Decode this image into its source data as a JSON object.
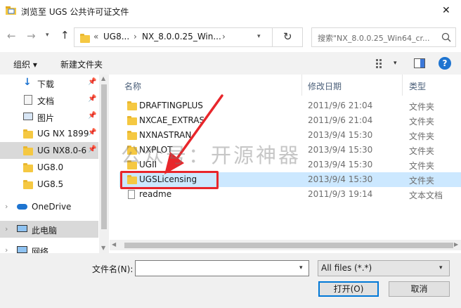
{
  "window": {
    "title": "浏览至 UGS 公共许可证文件",
    "close_glyph": "✕"
  },
  "address": {
    "chevron": "«",
    "crumbs": [
      "UG8...",
      "NX_8.0.0.25_Win..."
    ],
    "separator": "›",
    "search_placeholder": "搜索\"NX_8.0.0.25_Win64_cr..."
  },
  "toolbar": {
    "organize": "组织 ▾",
    "new_folder": "新建文件夹",
    "help": "?"
  },
  "sidebar": {
    "items": [
      {
        "label": "下载",
        "icon": "download-icon",
        "pinned": true
      },
      {
        "label": "文档",
        "icon": "document-icon",
        "pinned": true
      },
      {
        "label": "图片",
        "icon": "picture-icon",
        "pinned": true
      },
      {
        "label": "UG NX 1899",
        "icon": "folder-icon",
        "pinned": true
      },
      {
        "label": "UG NX8.0-6",
        "icon": "folder-icon",
        "pinned": true,
        "selected": true
      },
      {
        "label": "UG8.0",
        "icon": "folder-icon"
      },
      {
        "label": "UG8.5",
        "icon": "folder-icon"
      },
      {
        "label": "OneDrive",
        "icon": "cloud-icon"
      },
      {
        "label": "此电脑",
        "icon": "computer-icon",
        "highlighted": true
      },
      {
        "label": "网络",
        "icon": "network-icon"
      }
    ]
  },
  "columns": {
    "name": "名称",
    "date": "修改日期",
    "type": "类型"
  },
  "files": [
    {
      "name": "DRAFTINGPLUS",
      "date": "2011/9/6 21:04",
      "type": "文件夹",
      "kind": "folder"
    },
    {
      "name": "NXCAE_EXTRAS",
      "date": "2011/9/6 21:04",
      "type": "文件夹",
      "kind": "folder"
    },
    {
      "name": "NXNASTRAN",
      "date": "2013/9/4 15:30",
      "type": "文件夹",
      "kind": "folder"
    },
    {
      "name": "NXPLOT",
      "date": "2013/9/4 15:30",
      "type": "文件夹",
      "kind": "folder"
    },
    {
      "name": "UGII",
      "date": "2013/9/4 15:30",
      "type": "文件夹",
      "kind": "folder"
    },
    {
      "name": "UGSLicensing",
      "date": "2013/9/4 15:30",
      "type": "文件夹",
      "kind": "folder",
      "selected": true
    },
    {
      "name": "readme",
      "date": "2011/9/3 19:14",
      "type": "文本文档",
      "kind": "text"
    }
  ],
  "footer": {
    "filename_label": "文件名(N):",
    "filename_value": "",
    "filter_value": "All files (*.*)",
    "open": "打开(O)",
    "cancel": "取消"
  },
  "watermark": "公众号：开源神器",
  "colors": {
    "annotation": "#e8262b",
    "selection": "#cce8ff",
    "sidebar_selected": "#d9d9d9"
  }
}
